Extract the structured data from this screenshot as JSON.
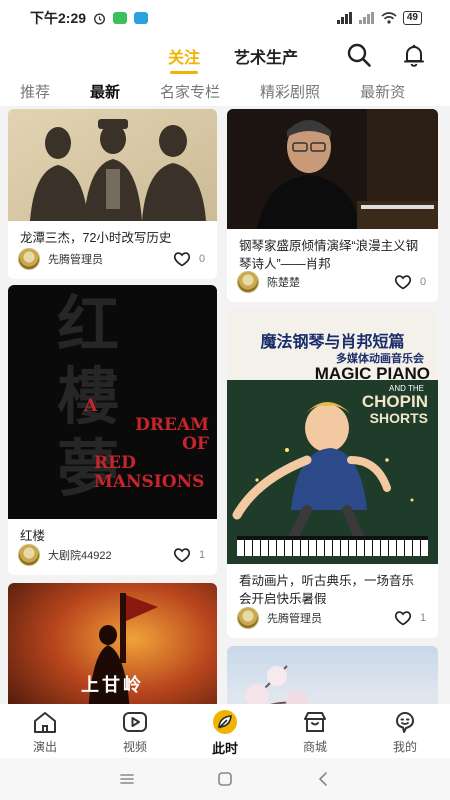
{
  "status_bar": {
    "time": "下午2:29",
    "battery": "49"
  },
  "top_tabs": {
    "follow": "关注",
    "art": "艺术生产"
  },
  "sub_tabs": [
    "推荐",
    "最新",
    "名家专栏",
    "精彩剧照",
    "最新资"
  ],
  "cards": [
    {
      "title": "龙潭三杰，72小时改写历史",
      "author": "先腾管理员",
      "likes": "0",
      "image_icon": "sketch-portrait-image"
    },
    {
      "title": "钢琴家盛原倾情演绎“浪漫主义钢琴诗人”——肖邦",
      "author": "陈楚楚",
      "likes": "0",
      "image_icon": "pianist-photo"
    },
    {
      "title": "红楼",
      "author": "大剧院44922",
      "likes": "1",
      "image_icon": "hongloumeng-poster",
      "poster": {
        "big": "红\n樓\n夢",
        "en_line1": "A",
        "en_line2": "DREAM",
        "en_line3": "OF",
        "en_line4": "RED",
        "en_line5": "MANSIONS"
      }
    },
    {
      "title": "看动画片，听古典乐，一场音乐会开启快乐暑假",
      "author": "先腾管理员",
      "likes": "1",
      "image_icon": "magic-piano-poster",
      "poster": {
        "cn_title": "魔法钢琴与肖邦短篇",
        "cn_sub": "多媒体动画音乐会",
        "en1": "MAGIC PIANO",
        "en2": "AND THE",
        "en3": "CHOPIN",
        "en4": "SHORTS"
      }
    },
    {
      "title": "上甘岭",
      "image_icon": "shangganling-poster"
    },
    {
      "title": "",
      "image_icon": "blossom-photo"
    }
  ],
  "bottom_nav": [
    {
      "label": "演出",
      "icon": "home-icon"
    },
    {
      "label": "视频",
      "icon": "play-icon"
    },
    {
      "label": "此时",
      "icon": "leaf-icon"
    },
    {
      "label": "商城",
      "icon": "shop-icon"
    },
    {
      "label": "我的",
      "icon": "profile-icon"
    }
  ],
  "colors": {
    "accent": "#f0b400",
    "poster_red": "#c6262b"
  }
}
